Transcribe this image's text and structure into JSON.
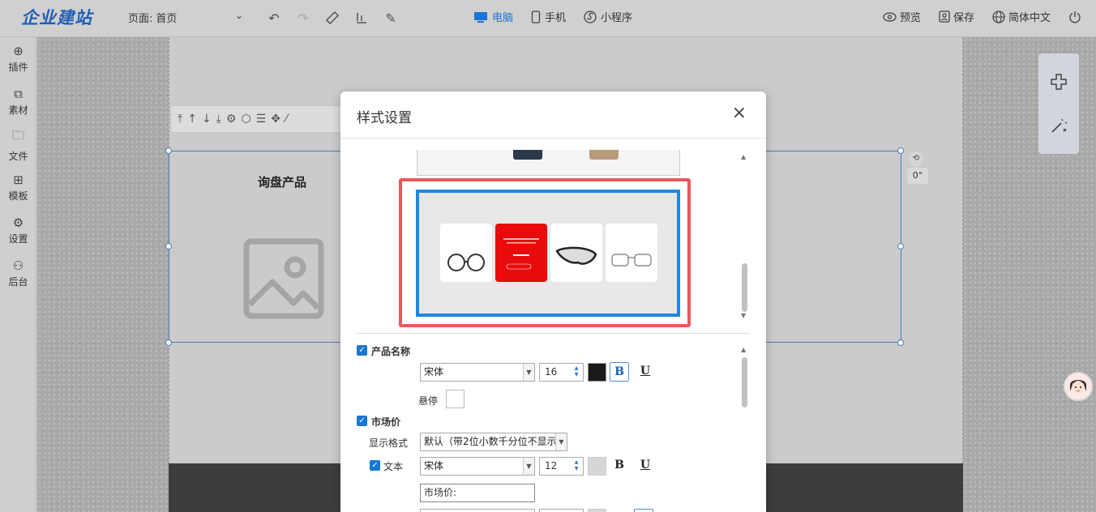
{
  "app": {
    "logo": "企业建站"
  },
  "topbar": {
    "page_label": "页面:",
    "page_value": "首页",
    "devices": [
      {
        "label": "电脑",
        "icon": "desktop-icon",
        "active": true
      },
      {
        "label": "手机",
        "icon": "mobile-icon",
        "active": false
      },
      {
        "label": "小程序",
        "icon": "miniprogram-icon",
        "active": false
      }
    ],
    "preview_label": "预览",
    "save_label": "保存",
    "lang_label": "简体中文"
  },
  "sidebar": {
    "items": [
      {
        "label": "插件",
        "icon": "plus-circle-icon"
      },
      {
        "label": "素材",
        "icon": "material-icon"
      },
      {
        "label": "文件",
        "icon": "file-icon"
      },
      {
        "label": "模板",
        "icon": "template-grid-icon"
      },
      {
        "label": "设置",
        "icon": "gear-icon"
      },
      {
        "label": "后台",
        "icon": "user-icon"
      }
    ]
  },
  "canvas": {
    "section_title": "询盘产品",
    "rotation": "0°"
  },
  "modal": {
    "title": "样式设置",
    "close": "×",
    "product_name": {
      "label": "产品名称",
      "checked": true,
      "font": "宋体",
      "size": "16",
      "color": "#1a1a1a",
      "bold": "B",
      "underline": "U",
      "hover_label": "悬停"
    },
    "market_price": {
      "label": "市场价",
      "checked": true,
      "format_label": "显示格式",
      "format_value": "默认（带2位小数千分位不显示",
      "text_label": "文本",
      "text_checked": true,
      "font": "宋体",
      "size": "12",
      "bold": "B",
      "underline": "U",
      "text_value": "市场价:"
    }
  },
  "colors": {
    "accent": "#1976d2",
    "preview_border": "#e9585e",
    "preview_select": "#1e88e5",
    "card_red": "#e90b0b"
  }
}
